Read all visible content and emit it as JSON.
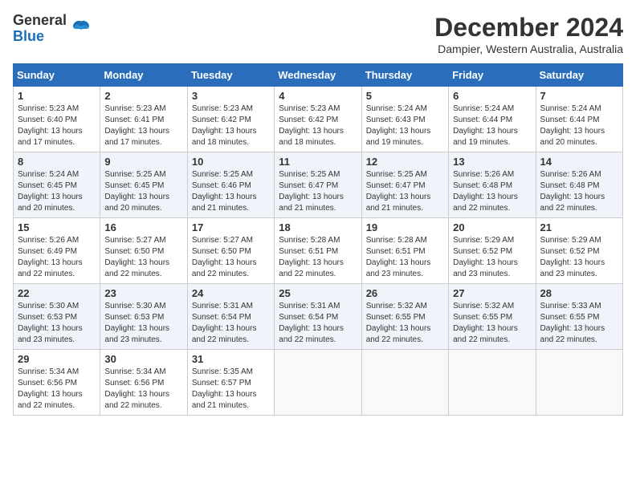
{
  "header": {
    "logo": {
      "general": "General",
      "blue": "Blue"
    },
    "month_title": "December 2024",
    "subtitle": "Dampier, Western Australia, Australia"
  },
  "calendar": {
    "days_of_week": [
      "Sunday",
      "Monday",
      "Tuesday",
      "Wednesday",
      "Thursday",
      "Friday",
      "Saturday"
    ],
    "weeks": [
      [
        {
          "day": "1",
          "sunrise": "5:23 AM",
          "sunset": "6:40 PM",
          "daylight": "13 hours and 17 minutes."
        },
        {
          "day": "2",
          "sunrise": "5:23 AM",
          "sunset": "6:41 PM",
          "daylight": "13 hours and 17 minutes."
        },
        {
          "day": "3",
          "sunrise": "5:23 AM",
          "sunset": "6:42 PM",
          "daylight": "13 hours and 18 minutes."
        },
        {
          "day": "4",
          "sunrise": "5:23 AM",
          "sunset": "6:42 PM",
          "daylight": "13 hours and 18 minutes."
        },
        {
          "day": "5",
          "sunrise": "5:24 AM",
          "sunset": "6:43 PM",
          "daylight": "13 hours and 19 minutes."
        },
        {
          "day": "6",
          "sunrise": "5:24 AM",
          "sunset": "6:44 PM",
          "daylight": "13 hours and 19 minutes."
        },
        {
          "day": "7",
          "sunrise": "5:24 AM",
          "sunset": "6:44 PM",
          "daylight": "13 hours and 20 minutes."
        }
      ],
      [
        {
          "day": "8",
          "sunrise": "5:24 AM",
          "sunset": "6:45 PM",
          "daylight": "13 hours and 20 minutes."
        },
        {
          "day": "9",
          "sunrise": "5:25 AM",
          "sunset": "6:45 PM",
          "daylight": "13 hours and 20 minutes."
        },
        {
          "day": "10",
          "sunrise": "5:25 AM",
          "sunset": "6:46 PM",
          "daylight": "13 hours and 21 minutes."
        },
        {
          "day": "11",
          "sunrise": "5:25 AM",
          "sunset": "6:47 PM",
          "daylight": "13 hours and 21 minutes."
        },
        {
          "day": "12",
          "sunrise": "5:25 AM",
          "sunset": "6:47 PM",
          "daylight": "13 hours and 21 minutes."
        },
        {
          "day": "13",
          "sunrise": "5:26 AM",
          "sunset": "6:48 PM",
          "daylight": "13 hours and 22 minutes."
        },
        {
          "day": "14",
          "sunrise": "5:26 AM",
          "sunset": "6:48 PM",
          "daylight": "13 hours and 22 minutes."
        }
      ],
      [
        {
          "day": "15",
          "sunrise": "5:26 AM",
          "sunset": "6:49 PM",
          "daylight": "13 hours and 22 minutes."
        },
        {
          "day": "16",
          "sunrise": "5:27 AM",
          "sunset": "6:50 PM",
          "daylight": "13 hours and 22 minutes."
        },
        {
          "day": "17",
          "sunrise": "5:27 AM",
          "sunset": "6:50 PM",
          "daylight": "13 hours and 22 minutes."
        },
        {
          "day": "18",
          "sunrise": "5:28 AM",
          "sunset": "6:51 PM",
          "daylight": "13 hours and 22 minutes."
        },
        {
          "day": "19",
          "sunrise": "5:28 AM",
          "sunset": "6:51 PM",
          "daylight": "13 hours and 23 minutes."
        },
        {
          "day": "20",
          "sunrise": "5:29 AM",
          "sunset": "6:52 PM",
          "daylight": "13 hours and 23 minutes."
        },
        {
          "day": "21",
          "sunrise": "5:29 AM",
          "sunset": "6:52 PM",
          "daylight": "13 hours and 23 minutes."
        }
      ],
      [
        {
          "day": "22",
          "sunrise": "5:30 AM",
          "sunset": "6:53 PM",
          "daylight": "13 hours and 23 minutes."
        },
        {
          "day": "23",
          "sunrise": "5:30 AM",
          "sunset": "6:53 PM",
          "daylight": "13 hours and 23 minutes."
        },
        {
          "day": "24",
          "sunrise": "5:31 AM",
          "sunset": "6:54 PM",
          "daylight": "13 hours and 22 minutes."
        },
        {
          "day": "25",
          "sunrise": "5:31 AM",
          "sunset": "6:54 PM",
          "daylight": "13 hours and 22 minutes."
        },
        {
          "day": "26",
          "sunrise": "5:32 AM",
          "sunset": "6:55 PM",
          "daylight": "13 hours and 22 minutes."
        },
        {
          "day": "27",
          "sunrise": "5:32 AM",
          "sunset": "6:55 PM",
          "daylight": "13 hours and 22 minutes."
        },
        {
          "day": "28",
          "sunrise": "5:33 AM",
          "sunset": "6:55 PM",
          "daylight": "13 hours and 22 minutes."
        }
      ],
      [
        {
          "day": "29",
          "sunrise": "5:34 AM",
          "sunset": "6:56 PM",
          "daylight": "13 hours and 22 minutes."
        },
        {
          "day": "30",
          "sunrise": "5:34 AM",
          "sunset": "6:56 PM",
          "daylight": "13 hours and 22 minutes."
        },
        {
          "day": "31",
          "sunrise": "5:35 AM",
          "sunset": "6:57 PM",
          "daylight": "13 hours and 21 minutes."
        },
        null,
        null,
        null,
        null
      ]
    ]
  }
}
